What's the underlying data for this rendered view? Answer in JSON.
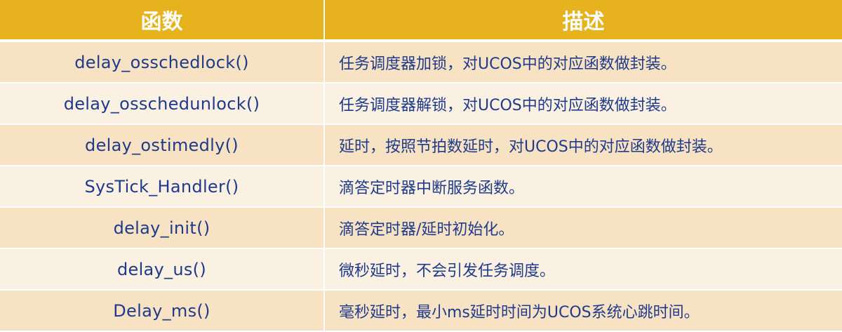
{
  "table": {
    "headers": [
      "函数",
      "描述"
    ],
    "rows": [
      {
        "function": "delay_osschedlock()",
        "description": "任务调度器加锁，对UCOS中的对应函数做封装。"
      },
      {
        "function": "delay_osschedunlock()",
        "description": "任务调度器解锁，对UCOS中的对应函数做封装。"
      },
      {
        "function": "delay_ostimedly()",
        "description": "延时，按照节拍数延时，对UCOS中的对应函数做封装。"
      },
      {
        "function": "SysTick_Handler()",
        "description": "滴答定时器中断服务函数。"
      },
      {
        "function": "delay_init()",
        "description": "滴答定时器/延时初始化。"
      },
      {
        "function": "delay_us()",
        "description": "微秒延时，不会引发任务调度。"
      },
      {
        "function": "Delay_ms()",
        "description": "毫秒延时，最小ms延时时间为UCOS系统心跳时间。"
      }
    ]
  },
  "colors": {
    "header_bg": "#e6b31e",
    "header_text": "#ffffff",
    "row_odd_bg": "#f7e3c4",
    "row_even_bg": "#fbf1e3",
    "body_text": "#1f3a8a"
  }
}
